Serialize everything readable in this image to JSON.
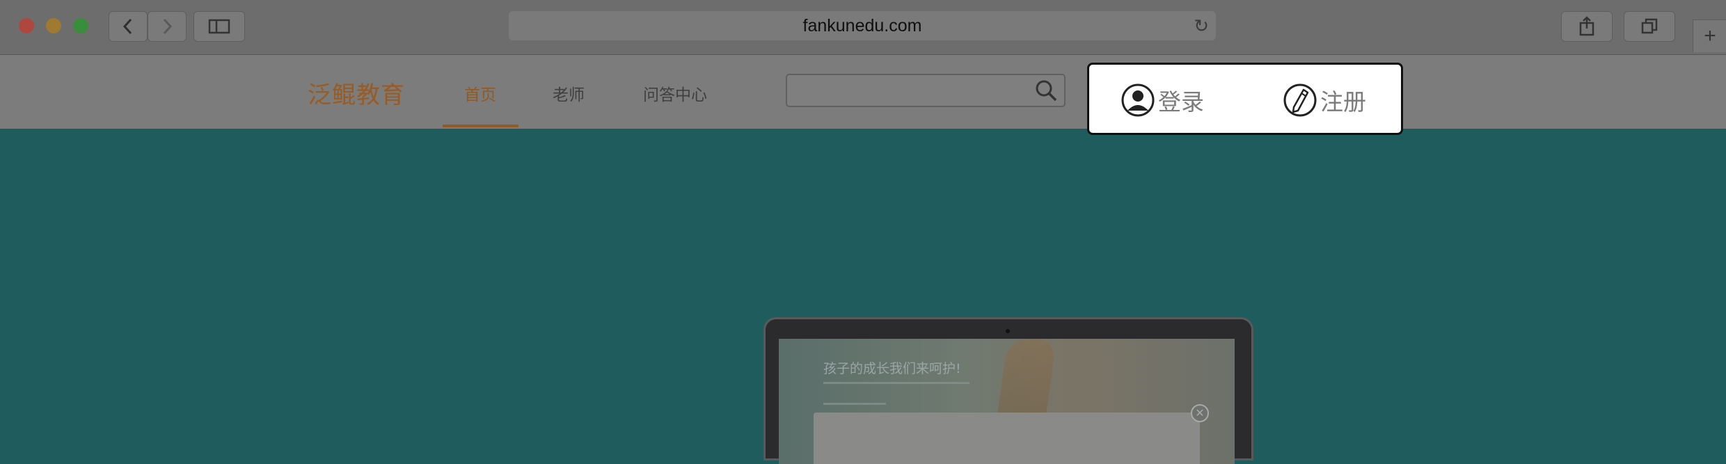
{
  "browser": {
    "url": "fankunedu.com",
    "icons": {
      "back": "chevron-left-icon",
      "forward": "chevron-right-icon",
      "sidebar": "sidebar-icon",
      "reload": "reload-icon",
      "share": "share-icon",
      "tabs": "tabs-icon",
      "new_tab": "plus-icon"
    }
  },
  "site": {
    "logo": "泛鲲教育",
    "nav": [
      {
        "label": "首页",
        "active": true
      },
      {
        "label": "老师",
        "active": false
      },
      {
        "label": "问答中心",
        "active": false
      }
    ],
    "search": {
      "value": "",
      "icon": "search-icon"
    }
  },
  "auth": {
    "login_label": "登录",
    "login_icon": "user-circle-icon",
    "register_label": "注册",
    "register_icon": "pencil-circle-icon"
  },
  "hero": {
    "screen_title": "孩子的成长我们来呵护!"
  },
  "colors": {
    "page_background": "#1f5c5e",
    "brand_orange": "#9a5b22",
    "auth_box_border": "#111111"
  }
}
